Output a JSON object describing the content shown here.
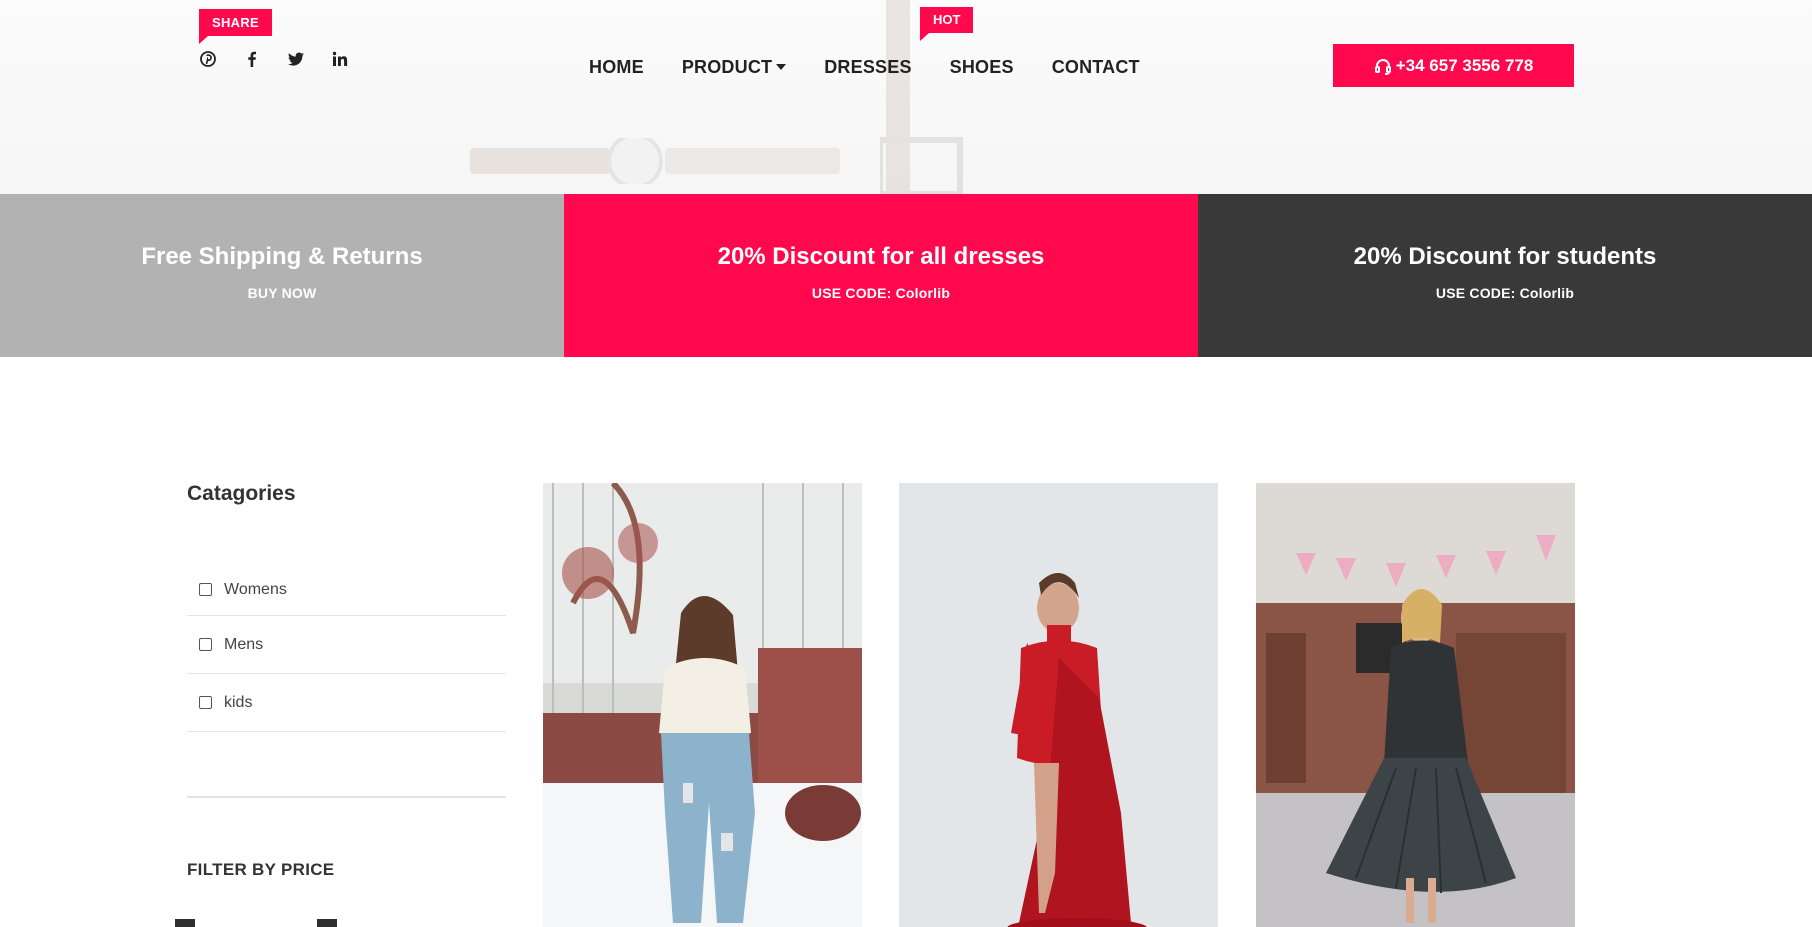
{
  "header": {
    "share_badge": "SHARE",
    "social_icons": [
      "pinterest-icon",
      "facebook-icon",
      "twitter-icon",
      "linkedin-icon"
    ],
    "nav": [
      {
        "label": "HOME"
      },
      {
        "label": "PRODUCT",
        "has_dropdown": true
      },
      {
        "label": "DRESSES"
      },
      {
        "label": "SHOES",
        "badge": "HOT"
      },
      {
        "label": "CONTACT"
      }
    ],
    "phone": "+34 657 3556 778"
  },
  "promos": [
    {
      "title": "Free Shipping & Returns",
      "subtitle": "BUY NOW",
      "color": "#b2b2b2"
    },
    {
      "title": "20% Discount for all dresses",
      "subtitle": "USE CODE: Colorlib",
      "color": "#ff084e"
    },
    {
      "title": "20% Discount for students",
      "subtitle": "USE CODE: Colorlib",
      "color": "#393939"
    }
  ],
  "sidebar": {
    "categories_title": "Catagories",
    "categories": [
      {
        "label": "Womens",
        "checked": false
      },
      {
        "label": "Mens",
        "checked": false
      },
      {
        "label": "kids",
        "checked": false
      }
    ],
    "price_title": "FILTER BY PRICE"
  },
  "colors": {
    "accent": "#ff084e",
    "grey_banner": "#b2b2b2",
    "dark_banner": "#393939"
  }
}
